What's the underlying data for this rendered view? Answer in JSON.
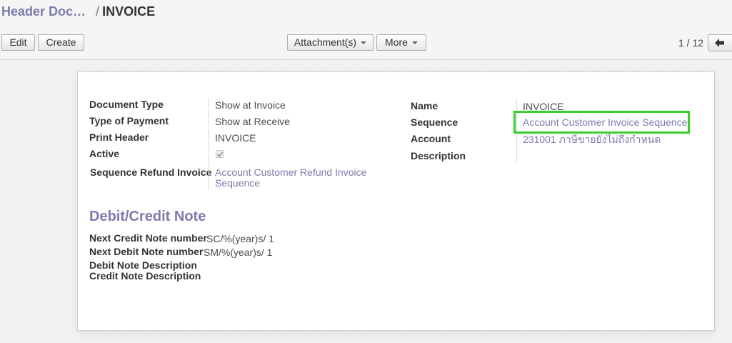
{
  "breadcrumb": {
    "parent": "Header Doc…",
    "separator": "/",
    "current": "INVOICE"
  },
  "toolbar": {
    "edit_label": "Edit",
    "create_label": "Create",
    "attachments_label": "Attachment(s)",
    "more_label": "More"
  },
  "pager": {
    "value": "1 / 12"
  },
  "form": {
    "left_fields": [
      {
        "label": "Document Type",
        "value": "Show at Invoice"
      },
      {
        "label": "Type of Payment",
        "value": "Show at Receive"
      },
      {
        "label": "Print Header",
        "value": "INVOICE"
      },
      {
        "label": "Active",
        "value": true
      },
      {
        "label": "Sequence Refund Invoice",
        "value": "Account Customer Refund Invoice Sequence"
      }
    ],
    "right_fields": [
      {
        "label": "Name",
        "value": "INVOICE"
      },
      {
        "label": "Sequence",
        "value": "Account Customer Invoice Sequence"
      },
      {
        "label": "Account",
        "value": "231001 ภาษีขายยังไม่ถึงกำหนด"
      },
      {
        "label": "Description",
        "value": ""
      }
    ],
    "debit_credit": {
      "title": "Debit/Credit Note",
      "fields": [
        {
          "label": "Next Credit Note number",
          "value": "SC/%(year)s/ 1"
        },
        {
          "label": "Next Debit Note number",
          "value": "SM/%(year)s/ 1"
        },
        {
          "label": "Debit Note Description",
          "value": ""
        },
        {
          "label": "Credit Note Description",
          "value": ""
        }
      ]
    }
  },
  "colors": {
    "link": "#7c7bad",
    "highlight": "#35d02a"
  }
}
